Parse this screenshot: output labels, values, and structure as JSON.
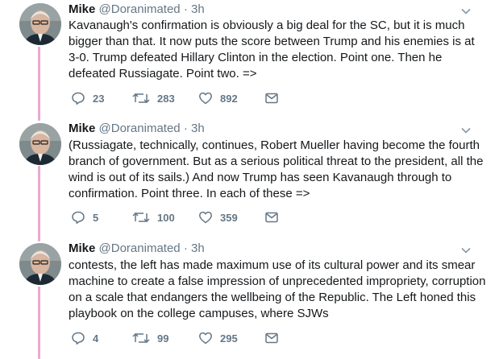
{
  "tweets": [
    {
      "name": "Mike",
      "handle": "@Doranimated",
      "separator": "·",
      "time": "3h",
      "text": "Kavanaugh's confirmation is obviously a big deal for the SC, but it is much bigger than that. It now puts the score between Trump and his enemies is at 3-0.  Trump defeated Hillary Clinton in the election. Point one. Then he defeated Russiagate. Point two. =>",
      "replies": "23",
      "retweets": "283",
      "likes": "892"
    },
    {
      "name": "Mike",
      "handle": "@Doranimated",
      "separator": "·",
      "time": "3h",
      "text": "(Russiagate, technically, continues, Robert Mueller having become the fourth branch of government. But as a serious political threat to the president, all the wind is out of its sails.) And now Trump has seen Kavanaugh through to confirmation. Point three.  In each of these =>",
      "replies": "5",
      "retweets": "100",
      "likes": "359"
    },
    {
      "name": "Mike",
      "handle": "@Doranimated",
      "separator": "·",
      "time": "3h",
      "text": "contests, the left has made maximum use of its cultural power and its smear machine to create a false impression of unprecedented impropriety, corruption on a scale that endangers the wellbeing of the Republic.  The Left honed this playbook on the college campuses, where SJWs",
      "replies": "4",
      "retweets": "99",
      "likes": "295"
    }
  ],
  "colors": {
    "thread_line": "#e9a9d1",
    "secondary_text": "#657786",
    "primary_text": "#14171a"
  },
  "icons": {
    "reply": "reply-icon",
    "retweet": "retweet-icon",
    "like": "heart-icon",
    "dm": "envelope-icon",
    "more": "chevron-down-icon"
  }
}
